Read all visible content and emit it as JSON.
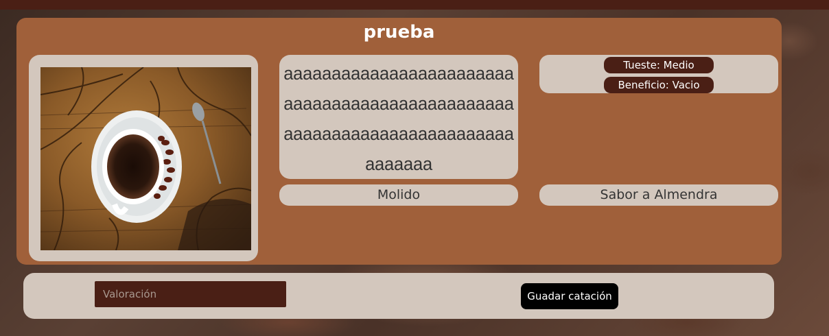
{
  "card": {
    "title": "prueba",
    "description": "aaaaaaaaaaaaaaaaaaaaaaaaaaaaaaaaaaaaaaaaaaaaaaaaaaaaaaaaaaaaaaaaaaaaaaaaaaaaaaa",
    "tueste_label": "Tueste: Medio",
    "beneficio_label": "Beneficio: Vacio",
    "molienda": "Molido",
    "sabor": "Sabor a Almendra"
  },
  "form": {
    "rating_placeholder": "Valoración",
    "rating_value": "",
    "save_label": "Guadar catación"
  },
  "colors": {
    "topbar": "#4a1f15",
    "card_bg": "#a0603a",
    "panel_bg": "#d3c7bd",
    "badge_bg": "#4a1f15",
    "button_bg": "#000000"
  }
}
